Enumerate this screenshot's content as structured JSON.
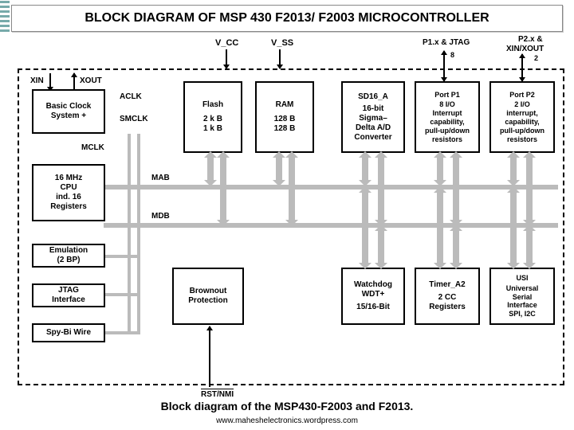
{
  "title": "BLOCK DIAGRAM OF MSP 430 F2013/ F2003 MICROCONTROLLER",
  "caption": "Block diagram of the MSP430-F2003 and F2013.",
  "footer": "www.maheshelectronics.wordpress.com",
  "pins": {
    "vcc": "V_CC",
    "vss": "V_SS",
    "p1": "P1.x & JTAG",
    "p1_bus": "8",
    "p2a": "P2.x &",
    "p2b": "XIN/XOUT",
    "p2_bus": "2",
    "xin": "XIN",
    "xout": "XOUT",
    "rst": "RST/NMI"
  },
  "clocks": {
    "aclk": "ACLK",
    "smclk": "SMCLK",
    "mclk": "MCLK"
  },
  "bus": {
    "mab": "MAB",
    "mdb": "MDB"
  },
  "blocks": {
    "basic_clock": [
      "Basic Clock",
      "System +"
    ],
    "flash": [
      "Flash",
      "",
      "2 k B",
      "1 k B"
    ],
    "ram": [
      "RAM",
      "",
      "128 B",
      "128 B"
    ],
    "sd16": [
      "SD16_A",
      "",
      "16-bit",
      "Sigma–",
      "Delta A/D",
      "Converter"
    ],
    "port1": [
      "Port P1",
      "",
      "8 I/O",
      "Interrupt",
      "capability,",
      "pull-up/down",
      "resistors"
    ],
    "port2": [
      "Port P2",
      "",
      "2 I/O",
      "interrupt,",
      "capability,",
      "pull-up/down",
      "resistors"
    ],
    "cpu": [
      "16 MHz",
      "CPU",
      "ind. 16",
      "Registers"
    ],
    "emulation": [
      "Emulation",
      "(2 BP)"
    ],
    "jtag": [
      "JTAG",
      "Interface"
    ],
    "spybi": [
      "Spy-Bi Wire"
    ],
    "brownout": [
      "Brownout",
      "Protection"
    ],
    "watchdog": [
      "Watchdog",
      "WDT+",
      "",
      "15/16-Bit"
    ],
    "timer": [
      "Timer_A2",
      "",
      "2 CC",
      "Registers"
    ],
    "usi": [
      "USI",
      "",
      "Universal",
      "Serial",
      "Interface",
      "SPI, I2C"
    ]
  }
}
